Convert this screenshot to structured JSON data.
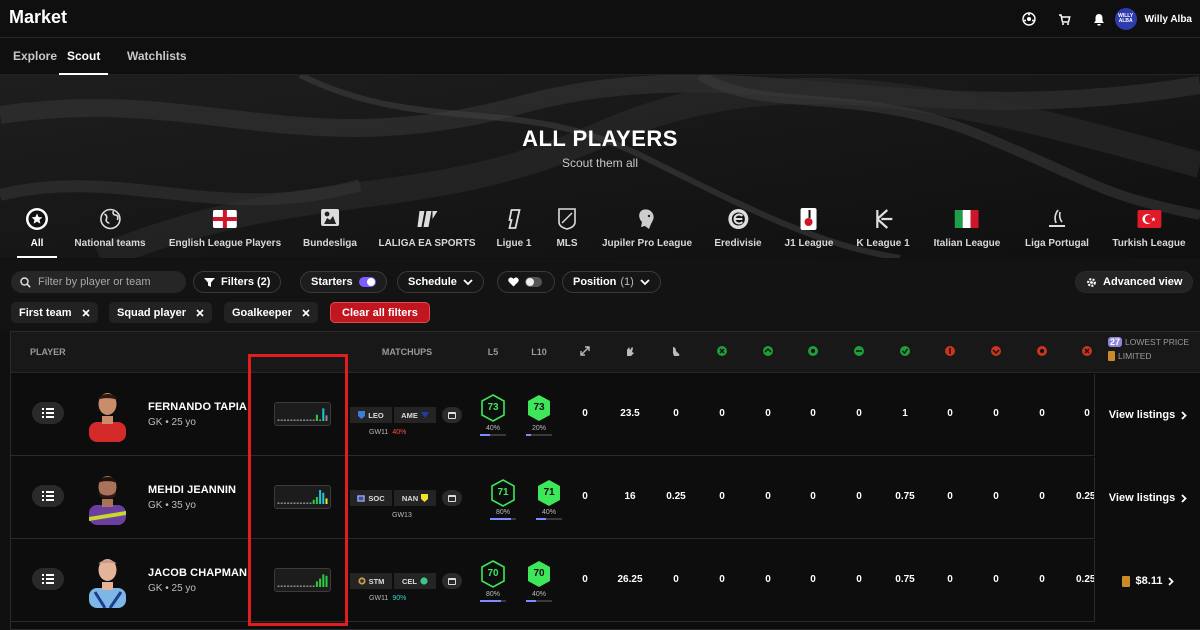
{
  "header": {
    "title": "Market",
    "user_name": "Willy Alba",
    "avatar_text": "WILLY ALBA"
  },
  "subnav": {
    "tabs": [
      "Explore",
      "Scout",
      "Watchlists"
    ],
    "active": "Scout"
  },
  "hero": {
    "title": "ALL PLAYERS",
    "subtitle": "Scout them all"
  },
  "categories": [
    {
      "label": "All",
      "icon": "star-badge-icon"
    },
    {
      "label": "National teams",
      "icon": "globe-icon"
    },
    {
      "label": "English League Players",
      "icon": "england-flag-icon"
    },
    {
      "label": "Bundesliga",
      "icon": "bundesliga-logo-icon"
    },
    {
      "label": "LALIGA EA SPORTS",
      "icon": "laliga-logo-icon"
    },
    {
      "label": "Ligue 1",
      "icon": "ligue1-logo-icon"
    },
    {
      "label": "MLS",
      "icon": "mls-logo-icon"
    },
    {
      "label": "Jupiler Pro League",
      "icon": "jupiler-lion-icon"
    },
    {
      "label": "Eredivisie",
      "icon": "eredivisie-logo-icon"
    },
    {
      "label": "J1 League",
      "icon": "j1-league-logo-icon"
    },
    {
      "label": "K League 1",
      "icon": "k-league-logo-icon"
    },
    {
      "label": "Italian League",
      "icon": "italy-flag-icon"
    },
    {
      "label": "Liga Portugal",
      "icon": "liga-portugal-logo-icon"
    },
    {
      "label": "Turkish League",
      "icon": "turkey-flag-icon"
    }
  ],
  "filters": {
    "search_placeholder": "Filter by player or team",
    "filters_label": "Filters",
    "filters_count": "(2)",
    "starters_label": "Starters",
    "schedule_label": "Schedule",
    "position_label": "Position",
    "position_count": "(1)",
    "advanced_label": "Advanced view",
    "chips": [
      "First team",
      "Squad player",
      "Goalkeeper"
    ],
    "clear_label": "Clear all filters"
  },
  "table": {
    "headers": {
      "player": "PLAYER",
      "matchups": "MATCHUPS",
      "l5": "L5",
      "l10": "L10"
    },
    "stat_icons": [
      "arrows-icon",
      "glove-icon",
      "foot-icon",
      "green-stat-1-icon",
      "green-stat-2-icon",
      "green-stat-3-icon",
      "green-stat-4-icon",
      "green-stat-5-icon",
      "red-stat-1-icon",
      "red-stat-2-icon",
      "red-stat-3-icon",
      "red-stat-4-icon"
    ],
    "lowest_price": {
      "badge": "27",
      "label": "LOWEST PRICE",
      "sub": "LIMITED"
    },
    "rows": [
      {
        "name": "FERNANDO TAPIA",
        "meta": "GK • 25 yo",
        "spark": [
          0.1,
          0.1,
          0.1,
          0.1,
          0.1,
          0.1,
          0.1,
          0.1,
          0.1,
          0.1,
          0.1,
          0.1,
          0.45,
          0.1,
          0.9,
          0.4
        ],
        "spark_colors": [
          "#8a8a8a",
          "#8a8a8a",
          "#8a8a8a",
          "#8a8a8a",
          "#8a8a8a",
          "#8a8a8a",
          "#8a8a8a",
          "#8a8a8a",
          "#8a8a8a",
          "#8a8a8a",
          "#8a8a8a",
          "#8a8a8a",
          "#2ecc40",
          "#8a8a8a",
          "#1ec8d8",
          "#8a8a8a"
        ],
        "home": "LEO",
        "away": "AME",
        "gw": "GW11",
        "gw_pct": "40%",
        "gw_pct_color": "#ff4b4b",
        "l5": "73",
        "l5_pct": "40%",
        "l5_fill": 0.4,
        "l10": "73",
        "l10_pct": "20%",
        "l10_fill": 0.2,
        "l5_outline": true,
        "l10_outline": false,
        "stats": [
          "0",
          "23.5",
          "0",
          "0",
          "0",
          "0",
          "0",
          "1",
          "0",
          "0",
          "0"
        ],
        "action": "View listings",
        "action_type": "listings"
      },
      {
        "name": "MEHDI JEANNIN",
        "meta": "GK • 35 yo",
        "spark": [
          0.1,
          0.1,
          0.1,
          0.1,
          0.1,
          0.1,
          0.1,
          0.1,
          0.1,
          0.1,
          0.1,
          0.3,
          0.5,
          1.0,
          0.8,
          0.4
        ],
        "spark_colors": [
          "#8a8a8a",
          "#8a8a8a",
          "#8a8a8a",
          "#8a8a8a",
          "#8a8a8a",
          "#8a8a8a",
          "#8a8a8a",
          "#8a8a8a",
          "#8a8a8a",
          "#8a8a8a",
          "#8a8a8a",
          "#2ecc40",
          "#2ecc40",
          "#1ec8d8",
          "#1ec8d8",
          "#f1e22a"
        ],
        "home": "SOC",
        "away": "NAN",
        "gw": "GW13",
        "gw_pct": "",
        "gw_pct_color": "#bbb",
        "l5": "71",
        "l5_pct": "80%",
        "l5_fill": 0.8,
        "l10": "71",
        "l10_pct": "40%",
        "l10_fill": 0.4,
        "l5_outline": true,
        "l10_outline": false,
        "stats": [
          "0",
          "16",
          "0.25",
          "0",
          "0",
          "0",
          "0",
          "0.75",
          "0",
          "0",
          "0.25"
        ],
        "action": "View listings",
        "action_type": "listings"
      },
      {
        "name": "JACOB CHAPMAN",
        "meta": "GK • 25 yo",
        "spark": [
          0.1,
          0.1,
          0.1,
          0.1,
          0.1,
          0.1,
          0.1,
          0.1,
          0.1,
          0.1,
          0.1,
          0.1,
          0.4,
          0.6,
          0.9,
          0.8
        ],
        "spark_colors": [
          "#8a8a8a",
          "#8a8a8a",
          "#8a8a8a",
          "#8a8a8a",
          "#8a8a8a",
          "#8a8a8a",
          "#8a8a8a",
          "#8a8a8a",
          "#8a8a8a",
          "#8a8a8a",
          "#8a8a8a",
          "#8a8a8a",
          "#2ecc40",
          "#2ecc40",
          "#2ecc40",
          "#2ecc40"
        ],
        "home": "STM",
        "away": "CEL",
        "gw": "GW11",
        "gw_pct": "90%",
        "gw_pct_color": "#36d6c8",
        "l5": "70",
        "l5_pct": "80%",
        "l5_fill": 0.8,
        "l10": "70",
        "l10_pct": "40%",
        "l10_fill": 0.4,
        "l5_outline": true,
        "l10_outline": false,
        "stats": [
          "0",
          "26.25",
          "0",
          "0",
          "0",
          "0",
          "0",
          "0.75",
          "0",
          "0",
          "0.25"
        ],
        "action": "$8.11",
        "action_type": "price"
      }
    ]
  },
  "colors": {
    "accent_purple": "#7f5cff",
    "score_green": "#3ee65a",
    "clear_red": "#c1151f",
    "highlight_red": "#e11d1d"
  }
}
